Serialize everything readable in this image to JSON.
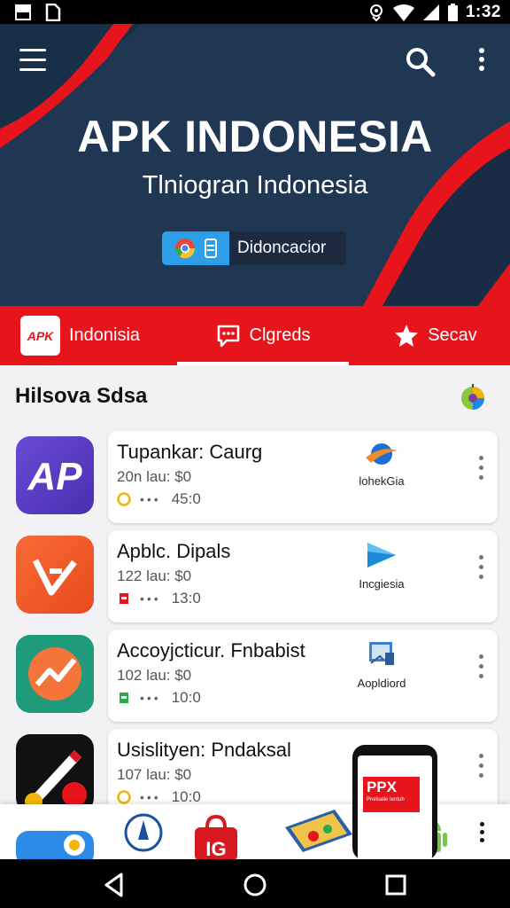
{
  "status_bar": {
    "time": "1:32",
    "left_icons": [
      "image-icon",
      "file-icon"
    ],
    "right_icons": [
      "location-icon",
      "wifi-icon",
      "signal-icon",
      "battery-icon"
    ]
  },
  "hero": {
    "title": "APK INDONESIA",
    "subtitle": "Tlniogran Indonesia",
    "pill_label": "Didoncacior",
    "colors": {
      "background": "#203754",
      "accent": "#e8141c",
      "pill": "#2d9ee8"
    }
  },
  "tabs": [
    {
      "label": "Indonisia",
      "icon": "apk-logo-icon",
      "badge": "APK"
    },
    {
      "label": "Clgreds",
      "icon": "chat-icon",
      "selected": true
    },
    {
      "label": "Secav",
      "icon": "star-icon"
    }
  ],
  "section": {
    "title": "Hilsova Sdsa",
    "icon": "globe-icon"
  },
  "apps": [
    {
      "name": "Tupankar: Caurg",
      "meta": "20n lau: $0",
      "stat": "45:0",
      "publisher": "lohekGia",
      "icon_text": "AP",
      "icon_color": "#5b3fc4"
    },
    {
      "name": "Apblc. Dipals",
      "meta": "122 lau: $0",
      "stat": "13:0",
      "publisher": "Incgiesia",
      "icon_color": "#f0562a"
    },
    {
      "name": "Accoyjcticur. Fnbabist",
      "meta": "102 lau: $0",
      "stat": "10:0",
      "publisher": "Aopldiord",
      "icon_color": "#1f9a7a"
    },
    {
      "name": "Usislityen: Pndaksal",
      "meta": "107 lau: $0",
      "stat": "10:0",
      "icon_color": "#111111"
    }
  ],
  "promo": {
    "banner": "PPX",
    "caption": "Pnelsalie Ientuh"
  },
  "bottom_shelf": {
    "items": [
      "app-thumb-icon",
      "emblem-icon",
      "shopping-bag-icon",
      "book-icon",
      "android-icon"
    ],
    "shopping_bag_text": "IG"
  },
  "nav": [
    "back-icon",
    "home-icon",
    "recents-icon"
  ]
}
